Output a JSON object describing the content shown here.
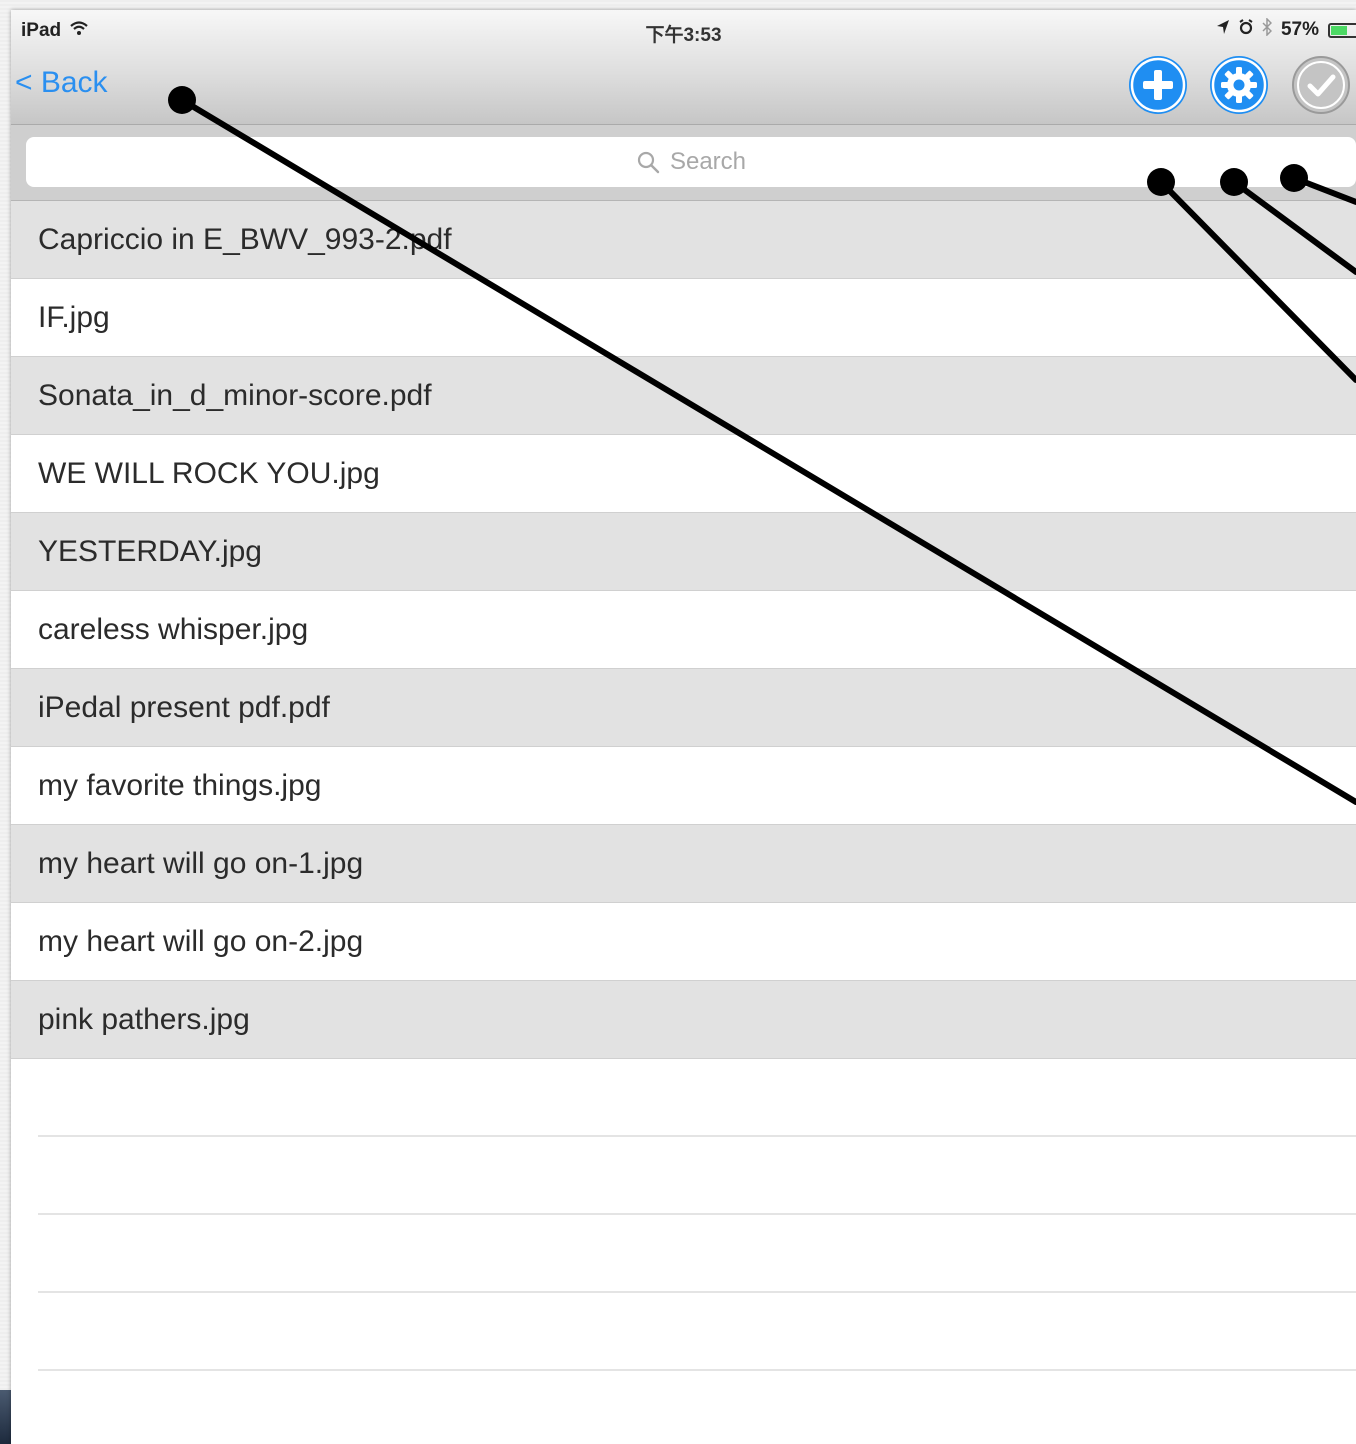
{
  "status_bar": {
    "device": "iPad",
    "time": "下午3:53",
    "battery": "57%",
    "battery_level": 0.57,
    "icons": [
      "wifi-icon",
      "location-icon",
      "alarm-icon",
      "bluetooth-icon",
      "battery-icon"
    ]
  },
  "nav": {
    "back_label": "< Back",
    "buttons": [
      "add-icon",
      "settings-icon",
      "checkmark-icon"
    ]
  },
  "search": {
    "placeholder": "Search"
  },
  "files": [
    "Capriccio in E_BWV_993-2.pdf",
    "IF.jpg",
    "Sonata_in_d_minor-score.pdf",
    "WE WILL ROCK YOU.jpg",
    "YESTERDAY.jpg",
    "careless whisper.jpg",
    "iPedal present pdf.pdf",
    "my favorite things.jpg",
    "my heart will go on-1.jpg",
    "my heart will go on-2.jpg",
    "pink pathers.jpg"
  ],
  "colors": {
    "accent_blue": "#1f8ef2",
    "back_link": "#2a8ff0",
    "row_alt": "#e2e2e2",
    "disabled_button": "#c4c4c4",
    "callout_line": "#000000"
  }
}
